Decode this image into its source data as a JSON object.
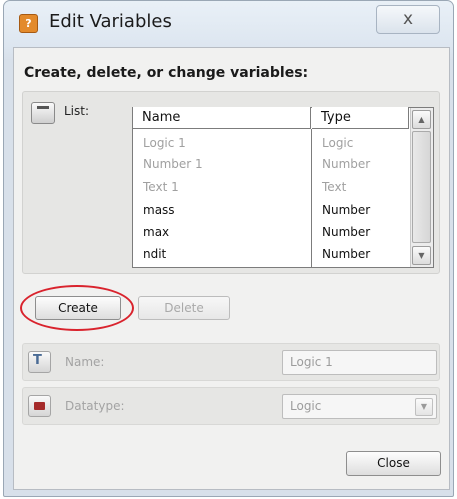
{
  "window": {
    "title": "Edit Variables",
    "close_glyph": "ⅹ",
    "app_icon_glyph": "?"
  },
  "heading": "Create, delete, or change variables:",
  "list": {
    "label": "List:",
    "columns": [
      "Name",
      "Type"
    ],
    "rows": [
      {
        "name": "Logic 1",
        "type": "Logic",
        "enabled": false
      },
      {
        "name": "Number 1",
        "type": "Number",
        "enabled": false
      },
      {
        "name": "Text 1",
        "type": "Text",
        "enabled": false
      },
      {
        "name": "mass",
        "type": "Number",
        "enabled": true
      },
      {
        "name": "max",
        "type": "Number",
        "enabled": true
      },
      {
        "name": "ndit",
        "type": "Number",
        "enabled": true
      }
    ],
    "scroll_up_glyph": "▲",
    "scroll_down_glyph": "▼"
  },
  "buttons": {
    "create": "Create",
    "delete": "Delete",
    "close": "Close"
  },
  "name_field": {
    "label": "Name:",
    "value": "Logic 1"
  },
  "datatype_field": {
    "label": "Datatype:",
    "value": "Logic",
    "arrow_glyph": "▼"
  },
  "colors": {
    "highlight_circle": "#d9232d",
    "disabled_text": "#a0a0a0"
  }
}
